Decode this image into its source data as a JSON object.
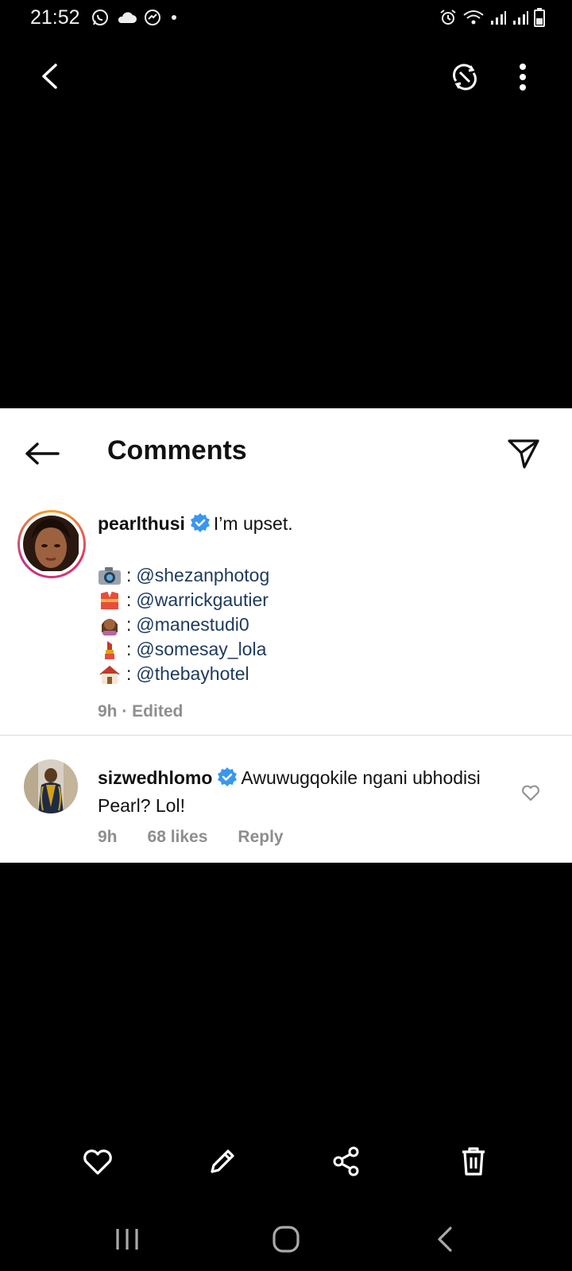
{
  "status": {
    "time": "21:52",
    "left_icons": [
      "whatsapp-icon",
      "cloud-icon",
      "messenger-icon",
      "dot-icon"
    ],
    "right_icons": [
      "alarm-icon",
      "wifi-icon",
      "signal-icon",
      "signal-icon",
      "battery-icon"
    ]
  },
  "viewer": {
    "back_icon": "chevron-left-icon",
    "rotate_icon": "rotate-icon",
    "more_icon": "more-vertical-icon"
  },
  "comments": {
    "title": "Comments",
    "back_icon": "arrow-left-icon",
    "send_icon": "paper-plane-icon",
    "post": {
      "username": "pearlthusi",
      "caption": "I’m upset.",
      "credits": [
        {
          "emoji": "camera",
          "sep": ":",
          "mention": "@shezanphotog"
        },
        {
          "emoji": "kimono",
          "sep": ":",
          "mention": "@warrickgautier"
        },
        {
          "emoji": "haircut",
          "sep": ":",
          "mention": "@manestudi0"
        },
        {
          "emoji": "lipstick",
          "sep": ":",
          "mention": "@somesay_lola"
        },
        {
          "emoji": "house",
          "sep": ":",
          "mention": "@thebayhotel"
        }
      ],
      "meta": "9h · Edited"
    },
    "comment": {
      "username": "sizwedhlomo",
      "text": "Awuwugqokile ngani ubhodisi Pearl? Lol!",
      "time": "9h",
      "likes": "68 likes",
      "reply": "Reply"
    }
  },
  "actions": {
    "like": "heart-icon",
    "edit": "pencil-icon",
    "share": "share-icon",
    "delete": "trash-icon"
  },
  "nav": {
    "recents": "recents-icon",
    "home": "home-icon",
    "back": "back-icon"
  },
  "colors": {
    "mention": "#1d3a5e",
    "verified": "#3897f0",
    "meta": "#8e8e8e"
  }
}
